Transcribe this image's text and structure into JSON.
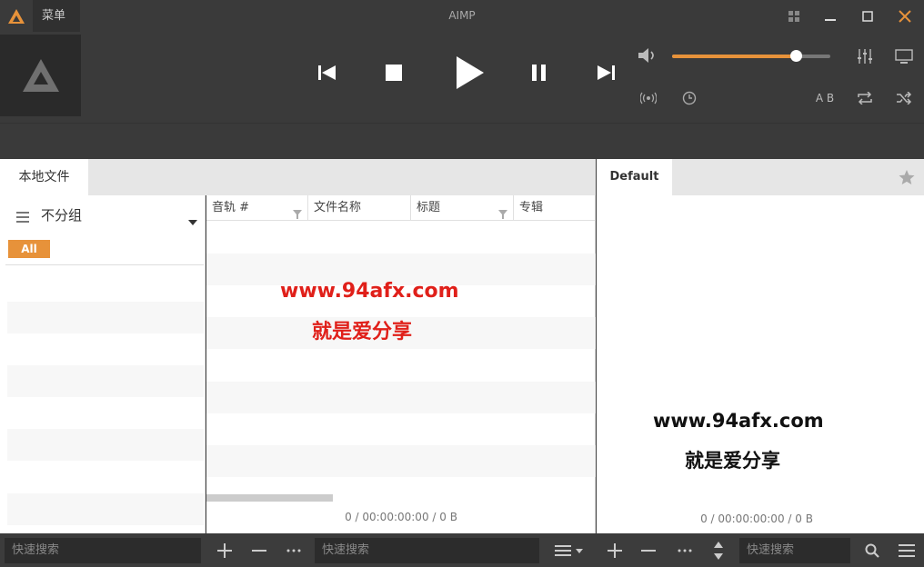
{
  "window": {
    "menu_label": "菜单",
    "title": "AIMP"
  },
  "volume": {
    "level_fraction": 0.78
  },
  "tabs": {
    "left_active": "本地文件",
    "right_active": "Default"
  },
  "library": {
    "grouping_label": "不分组",
    "all_badge": "All"
  },
  "columns": [
    {
      "label": "音轨 #"
    },
    {
      "label": "文件名称"
    },
    {
      "label": "标题"
    },
    {
      "label": "专辑"
    }
  ],
  "status": {
    "middle": "0 / 00:00:00:00 / 0 B",
    "right": "0 / 00:00:00:00 / 0 B"
  },
  "watermark": {
    "url": "www.94afx.com",
    "tagline": "就是爱分享"
  },
  "bottom": {
    "search_left_placeholder": "快速搜索",
    "search_mid_placeholder": "快速搜索",
    "search_right_placeholder": "快速搜索"
  },
  "labels": {
    "ab_repeat": "A B"
  },
  "colors": {
    "accent": "#e7923a",
    "dark_bg": "#3a3a3a",
    "panel_bg": "#ffffff",
    "watermark_red": "#e0201a"
  },
  "icons": [
    "aimp-logo-icon",
    "minimize-icon",
    "maximize-icon",
    "close-icon",
    "grid-icon",
    "prev-icon",
    "stop-icon",
    "play-icon",
    "pause-icon",
    "next-icon",
    "volume-icon",
    "equalizer-icon",
    "miniplayer-icon",
    "radio-icon",
    "clock-icon",
    "repeat-icon",
    "shuffle-icon",
    "star-icon",
    "hamburger-icon",
    "dropdown-icon",
    "filter-icon",
    "plus-icon",
    "minus-icon",
    "more-icon",
    "sort-icon",
    "search-icon"
  ]
}
